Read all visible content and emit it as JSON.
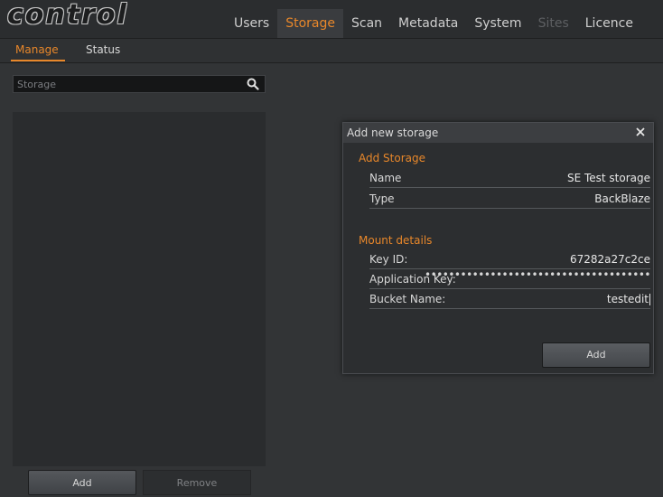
{
  "app": {
    "logo": "control"
  },
  "nav": {
    "items": [
      {
        "label": "Users",
        "state": "normal"
      },
      {
        "label": "Storage",
        "state": "active"
      },
      {
        "label": "Scan",
        "state": "normal"
      },
      {
        "label": "Metadata",
        "state": "normal"
      },
      {
        "label": "System",
        "state": "normal"
      },
      {
        "label": "Sites",
        "state": "disabled"
      },
      {
        "label": "Licence",
        "state": "normal"
      }
    ]
  },
  "subnav": {
    "manage": "Manage",
    "status": "Status"
  },
  "search": {
    "placeholder": "Storage",
    "value": "",
    "icon": "search-icon"
  },
  "storage_list": {
    "items": []
  },
  "left_buttons": {
    "add": "Add",
    "remove": "Remove"
  },
  "dialog": {
    "title": "Add new storage",
    "close_icon": "close-icon",
    "add_storage": {
      "section_title": "Add Storage",
      "name_label": "Name",
      "name_value": "SE Test storage",
      "type_label": "Type",
      "type_value": "BackBlaze"
    },
    "mount_details": {
      "section_title": "Mount details",
      "key_id_label": "Key ID:",
      "key_id_value": "67282a27c2ce",
      "app_key_label": "Application Key:",
      "app_key_value": "••••••••••••••••••••••••••••••••••••••",
      "bucket_label": "Bucket Name:",
      "bucket_value": "testedit"
    },
    "add_button": "Add"
  },
  "colors": {
    "accent": "#e8872a",
    "background": "#323436",
    "panel": "#2a2c2e"
  }
}
